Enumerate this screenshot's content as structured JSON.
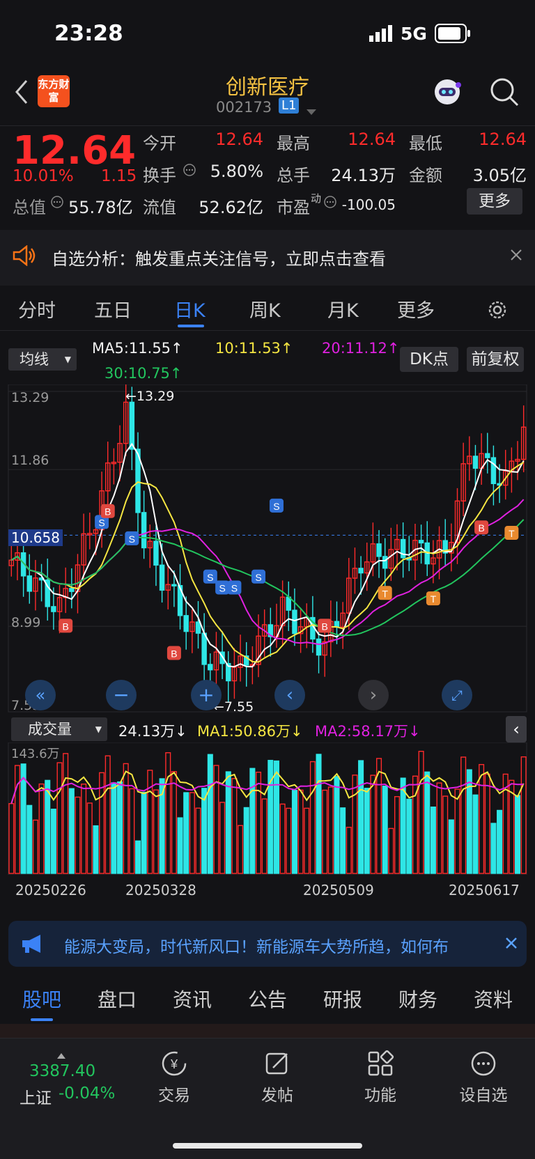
{
  "status": {
    "time": "23:28",
    "network": "5G"
  },
  "header": {
    "title": "创新医疗",
    "code": "002173",
    "level": "L1",
    "logo_text": "东方财富"
  },
  "quote": {
    "price": "12.64",
    "change_pct": "10.01%",
    "change": "1.15",
    "stats": [
      {
        "label": "今开",
        "value": "12.64",
        "color": "red"
      },
      {
        "label": "最高",
        "value": "12.64",
        "color": "red"
      },
      {
        "label": "最低",
        "value": "12.64",
        "color": "red"
      },
      {
        "label": "换手",
        "value": "5.80%",
        "color": "white"
      },
      {
        "label": "总手",
        "value": "24.13万",
        "color": "white"
      },
      {
        "label": "金额",
        "value": "3.05亿",
        "color": "white"
      },
      {
        "label": "总值",
        "value": "55.78亿",
        "color": "white"
      },
      {
        "label": "流值",
        "value": "52.62亿",
        "color": "white"
      },
      {
        "label": "市盈",
        "value": "-100.05",
        "color": "white",
        "sup": "动"
      }
    ],
    "more_label": "更多"
  },
  "analysis": {
    "text": "自选分析：触发重点关注信号，立即点击查看"
  },
  "tabs": [
    "分时",
    "五日",
    "日K",
    "周K",
    "月K",
    "更多"
  ],
  "active_tab": "日K",
  "indicator": {
    "selector": "均线",
    "ma5": "MA5:11.55↑",
    "ma10": "10:11.53↑",
    "ma20": "20:11.12↑",
    "ma30": "30:10.75↑",
    "dk_label": "DK点",
    "adjust_label": "前复权"
  },
  "price_axis": {
    "top": "13.29",
    "upper": "11.86",
    "current": "10.658",
    "lower": "8.99",
    "bottom": "7.55"
  },
  "annotations": {
    "high": "←13.29",
    "low": "←7.55"
  },
  "volume": {
    "selector": "成交量",
    "current": "24.13万↓",
    "ma1": "MA1:50.86万↓",
    "ma2": "MA2:58.17万↓",
    "axis_top": "143.6万"
  },
  "dates": [
    "20250226",
    "20250328",
    "20250509",
    "20250617"
  ],
  "banner": {
    "text": "能源大变局，时代新风口！新能源车大势所趋，如何布"
  },
  "bottom_tabs": [
    "股吧",
    "盘口",
    "资讯",
    "公告",
    "研报",
    "财务",
    "资料"
  ],
  "footer": {
    "index_value": "3387.40",
    "index_name": "上证",
    "index_change": "-0.04%",
    "items": [
      {
        "label": "交易",
        "icon": "yen-icon"
      },
      {
        "label": "发帖",
        "icon": "edit-icon"
      },
      {
        "label": "功能",
        "icon": "grid-icon"
      },
      {
        "label": "设自选",
        "icon": "more-icon"
      }
    ]
  },
  "chart_data": {
    "type": "candlestick",
    "ylim": [
      7.55,
      13.29
    ],
    "last_close": 12.64,
    "high": 13.29,
    "low": 7.55,
    "volume_max_wan": 143.6
  }
}
